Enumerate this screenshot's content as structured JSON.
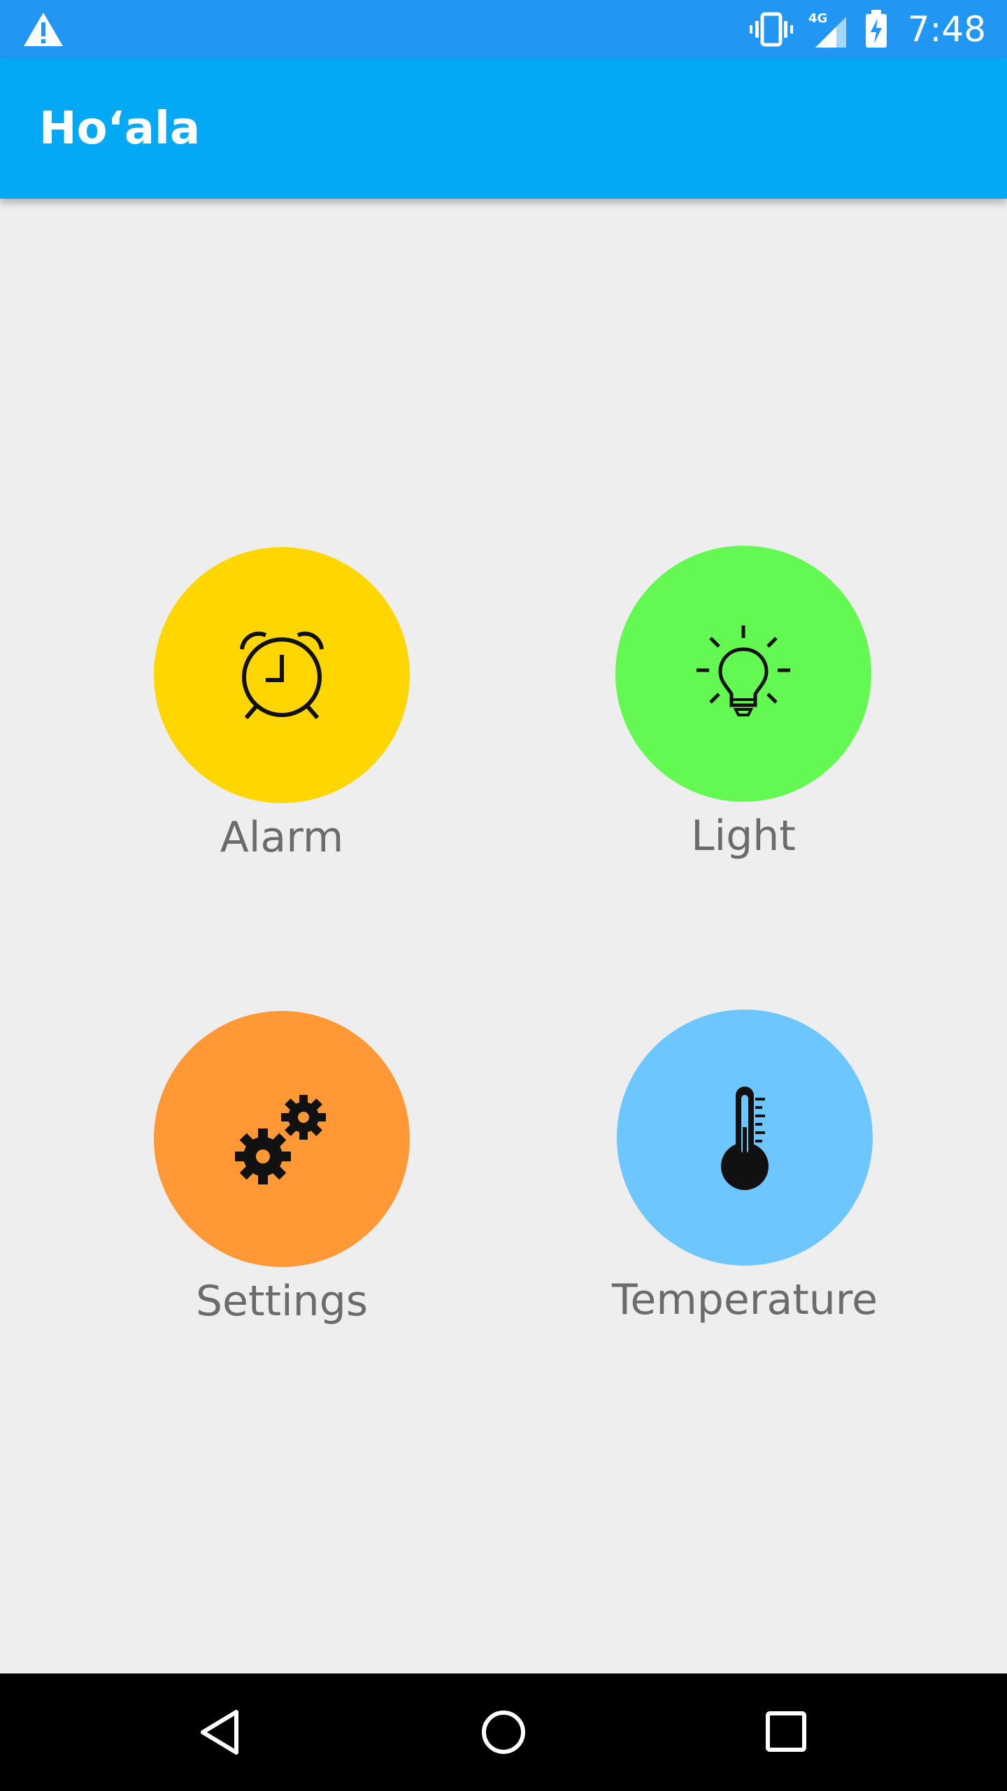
{
  "status_bar": {
    "time": "7:48",
    "icons": [
      "warning-icon",
      "vibrate-icon",
      "signal-4g-icon",
      "battery-charging-icon"
    ],
    "network_label": "4G"
  },
  "app_bar": {
    "title": "Ho‘ala"
  },
  "tiles": [
    {
      "label": "Alarm",
      "icon": "alarm-clock-icon",
      "color": "#ffd600"
    },
    {
      "label": "Light",
      "icon": "lightbulb-icon",
      "color": "#64f853"
    },
    {
      "label": "Settings",
      "icon": "gears-icon",
      "color": "#ff9835"
    },
    {
      "label": "Temperature",
      "icon": "thermometer-icon",
      "color": "#6ec6ff"
    }
  ],
  "nav_bar": {
    "buttons": [
      "back-icon",
      "home-icon",
      "recents-icon"
    ]
  },
  "colors": {
    "status_bar": "#2196f3",
    "app_bar": "#03a9f4",
    "background": "#eeeeee",
    "label_text": "#6b6b6b"
  }
}
